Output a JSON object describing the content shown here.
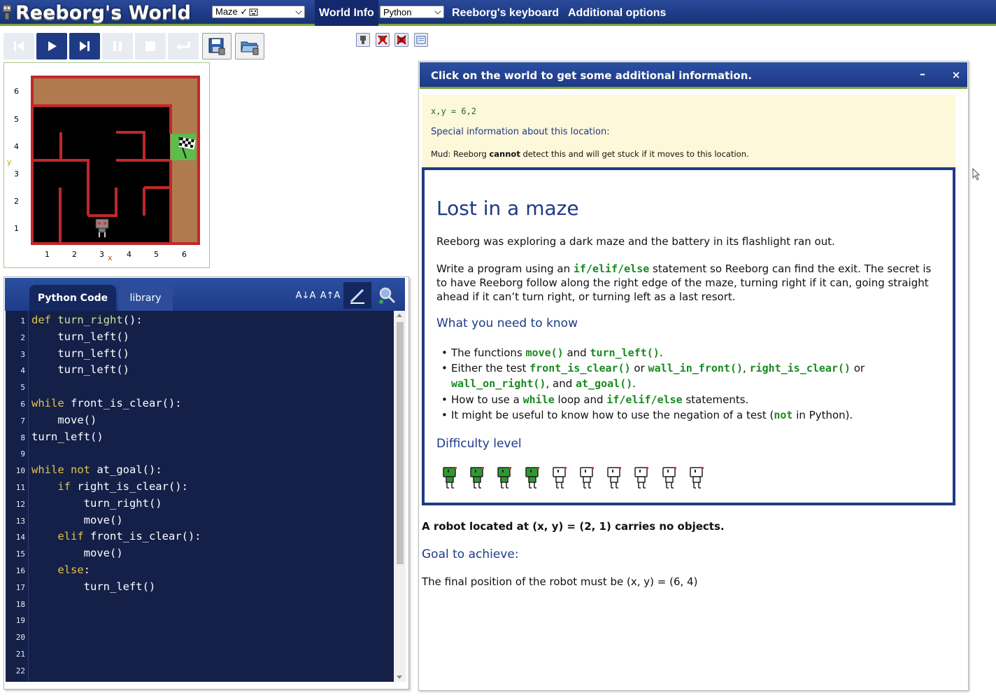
{
  "header": {
    "app_title": "Reeborg's World",
    "world_select": "Maze ✓",
    "world_info_label": "World Info",
    "language_select": "Python",
    "keyboard_label": "Reeborg's keyboard",
    "additional_options_label": "Additional options"
  },
  "world": {
    "y_ticks": [
      "6",
      "5",
      "4",
      "3",
      "2",
      "1"
    ],
    "x_ticks": [
      "1",
      "2",
      "3",
      "4",
      "5",
      "6"
    ],
    "x_axis": "x",
    "y_axis": "y"
  },
  "editor": {
    "tabs": [
      "Python Code",
      "library"
    ],
    "decrease_font_label": "A↓A",
    "increase_font_label": "A↑A",
    "line_numbers": [
      "1",
      "2",
      "3",
      "4",
      "5",
      "6",
      "7",
      "8",
      "9",
      "10",
      "11",
      "12",
      "13",
      "14",
      "15",
      "16",
      "17",
      "18",
      "19",
      "20",
      "21",
      "22"
    ],
    "code": [
      [
        {
          "t": "def ",
          "c": "kw"
        },
        {
          "t": "turn_right",
          "c": "fn"
        },
        {
          "t": "():",
          "c": ""
        }
      ],
      [
        {
          "t": "    turn_left()",
          "c": ""
        }
      ],
      [
        {
          "t": "    turn_left()",
          "c": ""
        }
      ],
      [
        {
          "t": "    turn_left()",
          "c": ""
        }
      ],
      [
        {
          "t": "",
          "c": ""
        }
      ],
      [
        {
          "t": "while ",
          "c": "kw"
        },
        {
          "t": "front_is_clear():",
          "c": ""
        }
      ],
      [
        {
          "t": "    move()",
          "c": ""
        }
      ],
      [
        {
          "t": "turn_left()",
          "c": ""
        }
      ],
      [
        {
          "t": "",
          "c": ""
        }
      ],
      [
        {
          "t": "while not ",
          "c": "kw"
        },
        {
          "t": "at_goal():",
          "c": ""
        }
      ],
      [
        {
          "t": "    ",
          "c": ""
        },
        {
          "t": "if ",
          "c": "kw"
        },
        {
          "t": "right_is_clear():",
          "c": ""
        }
      ],
      [
        {
          "t": "        turn_right()",
          "c": ""
        }
      ],
      [
        {
          "t": "        move()",
          "c": ""
        }
      ],
      [
        {
          "t": "    ",
          "c": ""
        },
        {
          "t": "elif ",
          "c": "kw"
        },
        {
          "t": "front_is_clear():",
          "c": ""
        }
      ],
      [
        {
          "t": "        move()",
          "c": ""
        }
      ],
      [
        {
          "t": "    ",
          "c": ""
        },
        {
          "t": "else",
          "c": "kw"
        },
        {
          "t": ":",
          "c": ""
        }
      ],
      [
        {
          "t": "        turn_left()",
          "c": ""
        }
      ],
      [],
      [],
      [],
      [],
      []
    ]
  },
  "info": {
    "title": "Click on the world to get some additional information.",
    "minimize_label": "–",
    "close_label": "×",
    "coords": "x,y = 6,2",
    "special_heading": "Special information about this location:",
    "mud_prefix": "Mud: Reeborg ",
    "mud_bold": "cannot",
    "mud_suffix": " detect this and will get stuck if it moves to this location.",
    "task_title": "Lost in a maze",
    "task_p1": "Reeborg was exploring a dark maze and the battery in its flashlight ran out.",
    "task_p2_a": "Write a program using an ",
    "task_p2_code": "if/elif/else",
    "task_p2_b": " statement so Reeborg can find the exit. The secret is to have Reeborg follow along the right edge of the maze, turning right if it can, going straight ahead if it can’t turn right, or turning left as a last resort.",
    "know_heading": "What you need to know",
    "b1_a": "The functions ",
    "b1_c1": "move()",
    "b1_b": " and ",
    "b1_c2": "turn_left()",
    "b1_end": ".",
    "b2_a": "Either the test ",
    "b2_c1": "front_is_clear()",
    "b2_or1": " or ",
    "b2_c2": "wall_in_front()",
    "b2_comma": ", ",
    "b2_c3": "right_is_clear()",
    "b2_or2": " or ",
    "b2_c4": "wall_on_right()",
    "b2_and": ", and ",
    "b2_c5": "at_goal()",
    "b2_end": ".",
    "b3_a": "How to use a ",
    "b3_c1": "while",
    "b3_b": " loop and ",
    "b3_c2": "if/elif/else",
    "b3_end": " statements.",
    "b4_a": "It might be useful to know how to use the negation of a test (",
    "b4_c1": "not",
    "b4_end": " in Python).",
    "difficulty_heading": "Difficulty level",
    "difficulty": 4,
    "difficulty_max": 10,
    "robot_info": "A robot located at (x, y) = (2, 1) carries no objects.",
    "goal_heading": "Goal to achieve:",
    "goal_text": "The final position of the robot must be (x, y) = (6, 4)"
  },
  "colors": {
    "brand_blue": "#1d3b86",
    "accent_green": "#7aa53a",
    "code_keyword": "#e3c34b",
    "code_green": "#198a1e",
    "maze_wall": "#c0282a"
  }
}
